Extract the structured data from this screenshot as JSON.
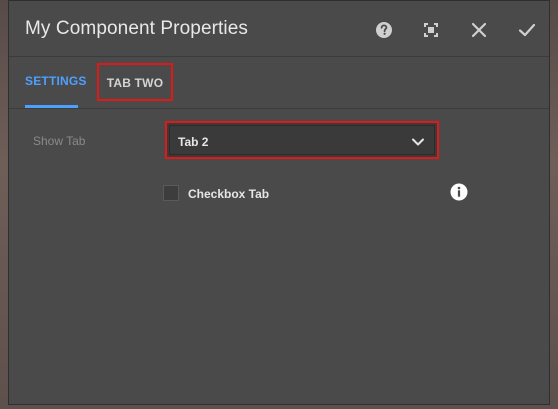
{
  "dialog": {
    "title": "My Component Properties",
    "icons": {
      "help": "help-icon",
      "fullscreen": "fullscreen-icon",
      "close": "close-icon",
      "done": "checkmark-icon"
    }
  },
  "tabs": [
    {
      "label": "SETTINGS",
      "active": true
    },
    {
      "label": "TAB TWO",
      "active": false
    }
  ],
  "form": {
    "show_tab_label": "Show Tab",
    "show_tab_value": "Tab 2",
    "checkbox_label": "Checkbox Tab",
    "checkbox_checked": false
  },
  "colors": {
    "accent": "#4ea0ff",
    "highlight": "#e01818",
    "dialog_bg": "#4a4a4a"
  }
}
